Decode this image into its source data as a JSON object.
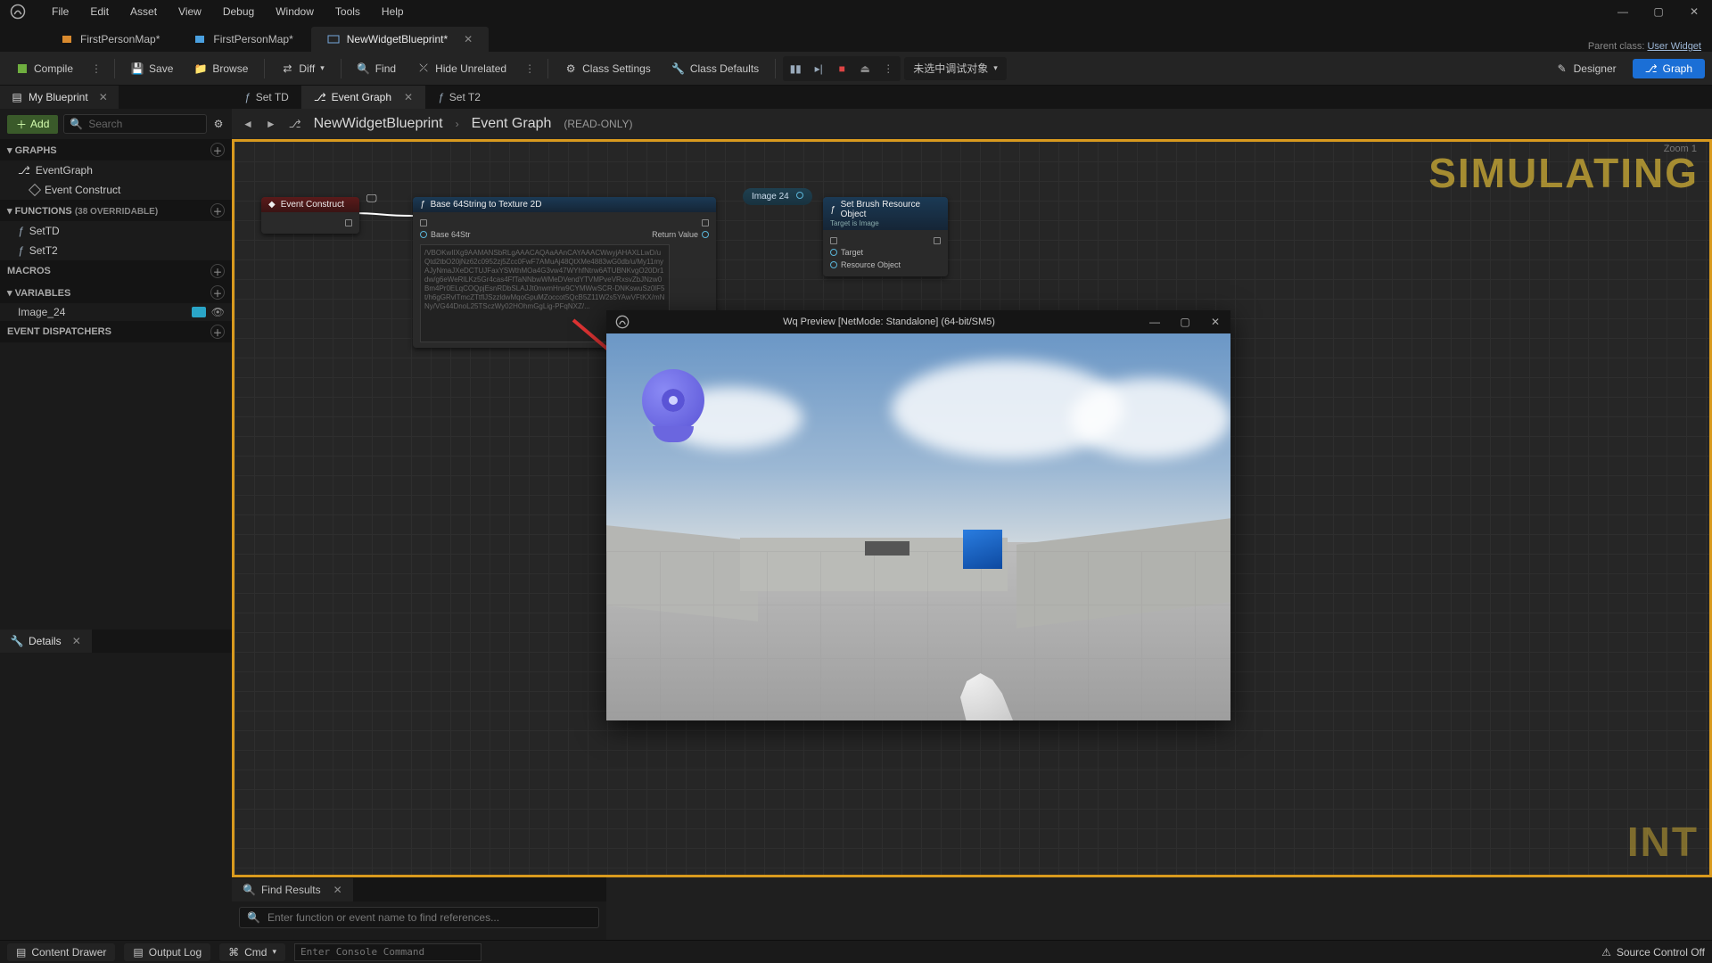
{
  "menubar": [
    "File",
    "Edit",
    "Asset",
    "View",
    "Debug",
    "Window",
    "Tools",
    "Help"
  ],
  "doc_tabs": [
    {
      "label": "FirstPersonMap*",
      "active": false,
      "iconColor": "#d98a2e"
    },
    {
      "label": "FirstPersonMap*",
      "active": false,
      "iconColor": "#4aa0e0"
    },
    {
      "label": "NewWidgetBlueprint*",
      "active": true,
      "iconColor": "#6aa0d8"
    }
  ],
  "parent_class": {
    "label": "Parent class:",
    "value": "User Widget"
  },
  "toolbar": {
    "compile": "Compile",
    "save": "Save",
    "browse": "Browse",
    "diff": "Diff",
    "find": "Find",
    "hide_unrelated": "Hide Unrelated",
    "class_settings": "Class Settings",
    "class_defaults": "Class Defaults",
    "debug_target": "未选中调试对象",
    "designer": "Designer",
    "graph": "Graph"
  },
  "left": {
    "my_blueprint": "My Blueprint",
    "add": "Add",
    "search_placeholder": "Search",
    "sections": {
      "graphs": "GRAPHS",
      "functions": "FUNCTIONS",
      "functions_badge": "(38 OVERRIDABLE)",
      "macros": "MACROS",
      "variables": "VARIABLES",
      "event_dispatchers": "EVENT DISPATCHERS"
    },
    "graph_items": [
      "EventGraph"
    ],
    "graph_children": [
      "Event Construct"
    ],
    "function_items": [
      "SetTD",
      "SetT2"
    ],
    "variable_items": [
      {
        "name": "Image_24",
        "type_color": "#2aa5c7"
      }
    ],
    "details": "Details"
  },
  "subtabs": [
    {
      "label": "Set TD",
      "kind": "fn",
      "active": false
    },
    {
      "label": "Event Graph",
      "kind": "graph",
      "active": true
    },
    {
      "label": "Set T2",
      "kind": "fn",
      "active": false
    }
  ],
  "graph_header": {
    "crumb1": "NewWidgetBlueprint",
    "crumb2": "Event Graph",
    "readonly": "(READ-ONLY)",
    "zoom": "Zoom 1",
    "watermark": "SIMULATING"
  },
  "nodes": {
    "event_construct": "Event Construct",
    "b64": "Base 64String to Texture 2D",
    "b64_input_label": "Base 64Str",
    "b64_output_label": "Return Value",
    "b64_text": "/VBOKwIIXg9AAMANSbRLgAAACAQAaAAnCAYAAACWwyjAHAXLLwD/uQtd2tbO20jNz62c0952zj5Zcc0FwF7AMuAj48QtXMe4883wG0db/u/My11myAJyNmaJXeDCTUJFaxYSWthMOa4G3vw47WYhfNtrw6ATUBNKvgO20Dr1dw/g6eWeRlLKz5Gr4cas4FfTaNNbwWMeDVendYTVMPveVRxsvZbJNzw0Bm4Pr0ELqCOQpjEsnRDbSLAJJt0nwmHrw9CYMWwSCR-DNKswuSz0lF5t/h6gGRvlTmcZTtflJSzzldwMqoGpuMZoccot5QcB5Z11W2s5YAwVFtKX/mNNy/VG44DnoL25TSczWy02HOhmGgLig-PFqNXZ/...",
    "var_image": "Image 24",
    "set_brush": "Set Brush Resource Object",
    "set_brush_sub": "Target is Image",
    "set_brush_pins": [
      "Target",
      "Resource Object"
    ]
  },
  "find": {
    "tab": "Find Results",
    "placeholder": "Enter function or event name to find references..."
  },
  "bottom": {
    "content_drawer": "Content Drawer",
    "output_log": "Output Log",
    "cmd": "Cmd",
    "cmd_placeholder": "Enter Console Command",
    "source_control": "Source Control Off"
  },
  "pie": {
    "title": "Wq Preview [NetMode: Standalone]  (64-bit/SM5)"
  }
}
